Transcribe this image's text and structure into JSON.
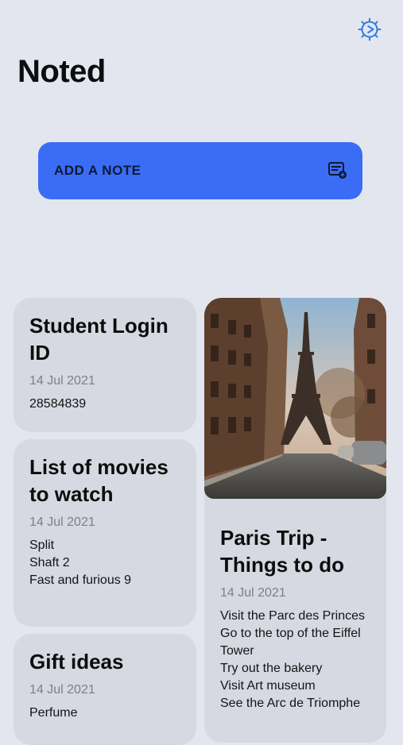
{
  "app": {
    "title": "Noted"
  },
  "header": {
    "settings_icon": "gear-icon"
  },
  "add_note": {
    "label": "ADD A NOTE",
    "icon": "note-add-icon",
    "color": "#3b6cf6"
  },
  "notes": [
    {
      "title": "Student Login ID",
      "date": "14 Jul 2021",
      "lines": [
        "28584839"
      ]
    },
    {
      "title": "List of movies to watch",
      "date": "14 Jul 2021",
      "lines": [
        "Split",
        "Shaft 2",
        "Fast and furious 9"
      ]
    },
    {
      "title": "Gift ideas",
      "date": "14 Jul 2021",
      "lines": [
        "Perfume"
      ]
    },
    {
      "title": "Paris Trip - Things to do",
      "date": "14 Jul 2021",
      "image": "eiffel-tower-photo",
      "lines": [
        "Visit the Parc des Princes",
        "Go to the top of the Eiffel",
        "Tower",
        "Try out the bakery",
        "Visit Art museum",
        "See the Arc de Triomphe"
      ]
    }
  ]
}
